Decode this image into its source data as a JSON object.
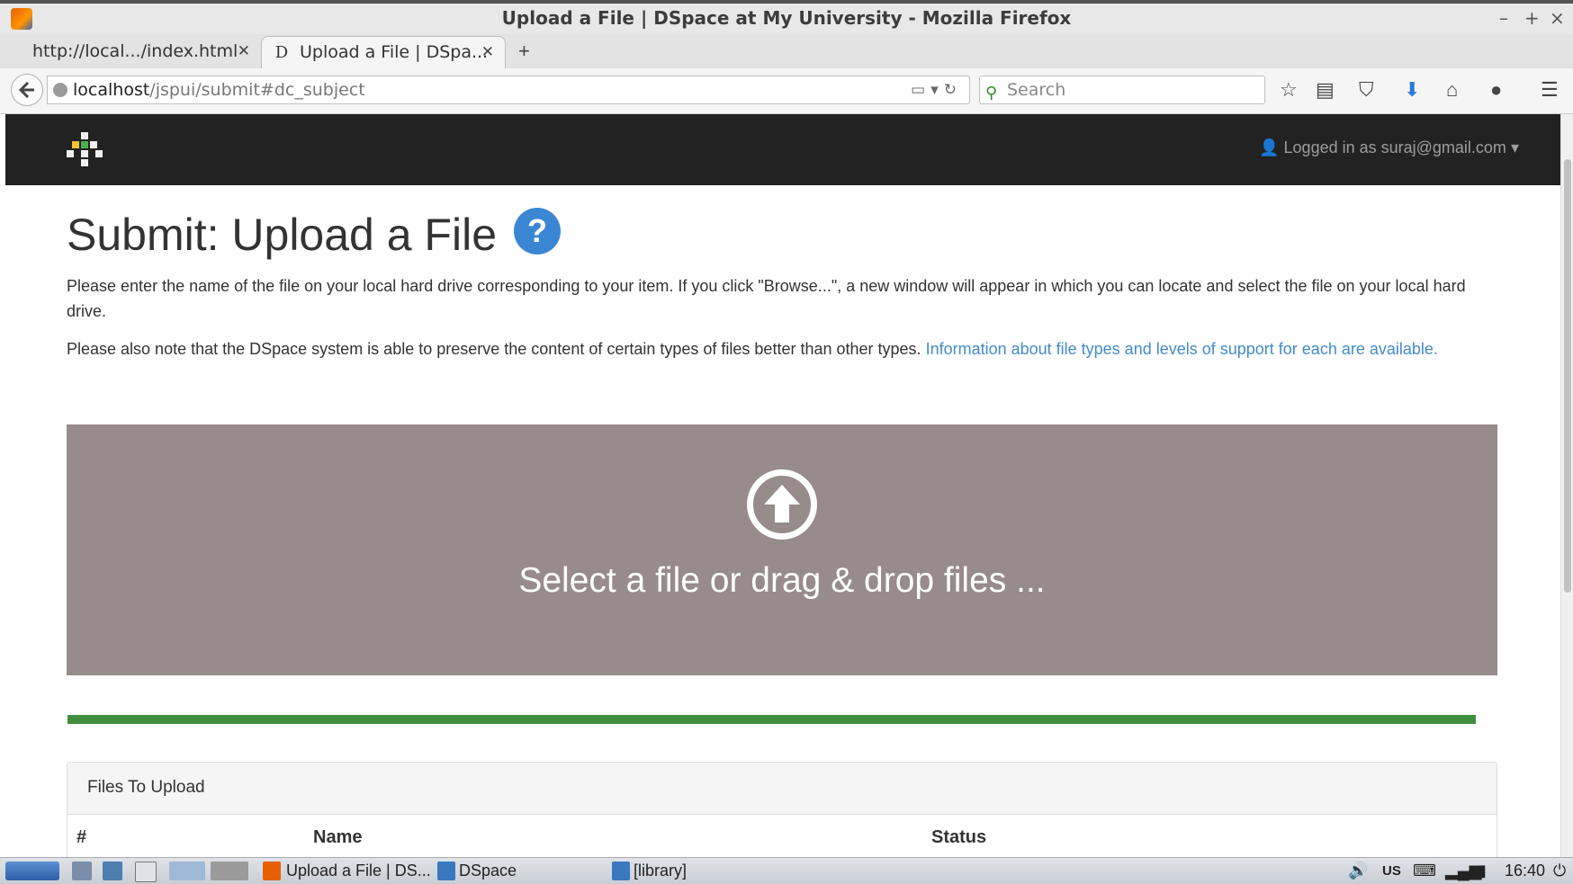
{
  "window": {
    "title": "Upload a File | DSpace at My University - Mozilla Firefox"
  },
  "tabs": [
    {
      "label": "http://local.../index.html",
      "active": false
    },
    {
      "label": "Upload a File | DSpa...",
      "active": true,
      "favicon": "D"
    }
  ],
  "navbar": {
    "url_host": "localhost",
    "url_path": "/jspui/submit#dc_subject",
    "search_placeholder": "Search"
  },
  "header": {
    "logged_in_text": "Logged in as suraj@gmail.com"
  },
  "page": {
    "title": "Submit: Upload a File",
    "help_glyph": "?",
    "para1": "Please enter the name of the file on your local hard drive corresponding to your item. If you click \"Browse...\", a new window will appear in which you can locate and select the file on your local hard drive.",
    "para2_text": "Please also note that the DSpace system is able to preserve the content of certain types of files better than other types.",
    "para2_link": "Information about file types and levels of support for each are available.",
    "dropzone_text": "Select a file or drag & drop files ...",
    "upload_progress": 1.0,
    "panel_title": "Files To Upload",
    "table_headers": [
      "#",
      "Name",
      "Status"
    ]
  },
  "taskbar": {
    "items": [
      "Upload a File | DS...",
      "DSpace",
      "[library]"
    ],
    "keyboard_layout": "US",
    "clock": "16:40"
  },
  "colors": {
    "header_bg": "#222222",
    "dropzone_bg": "#978b8b",
    "progress": "#3f8f3f",
    "link": "#428bca",
    "help_icon": "#3a86d3"
  }
}
